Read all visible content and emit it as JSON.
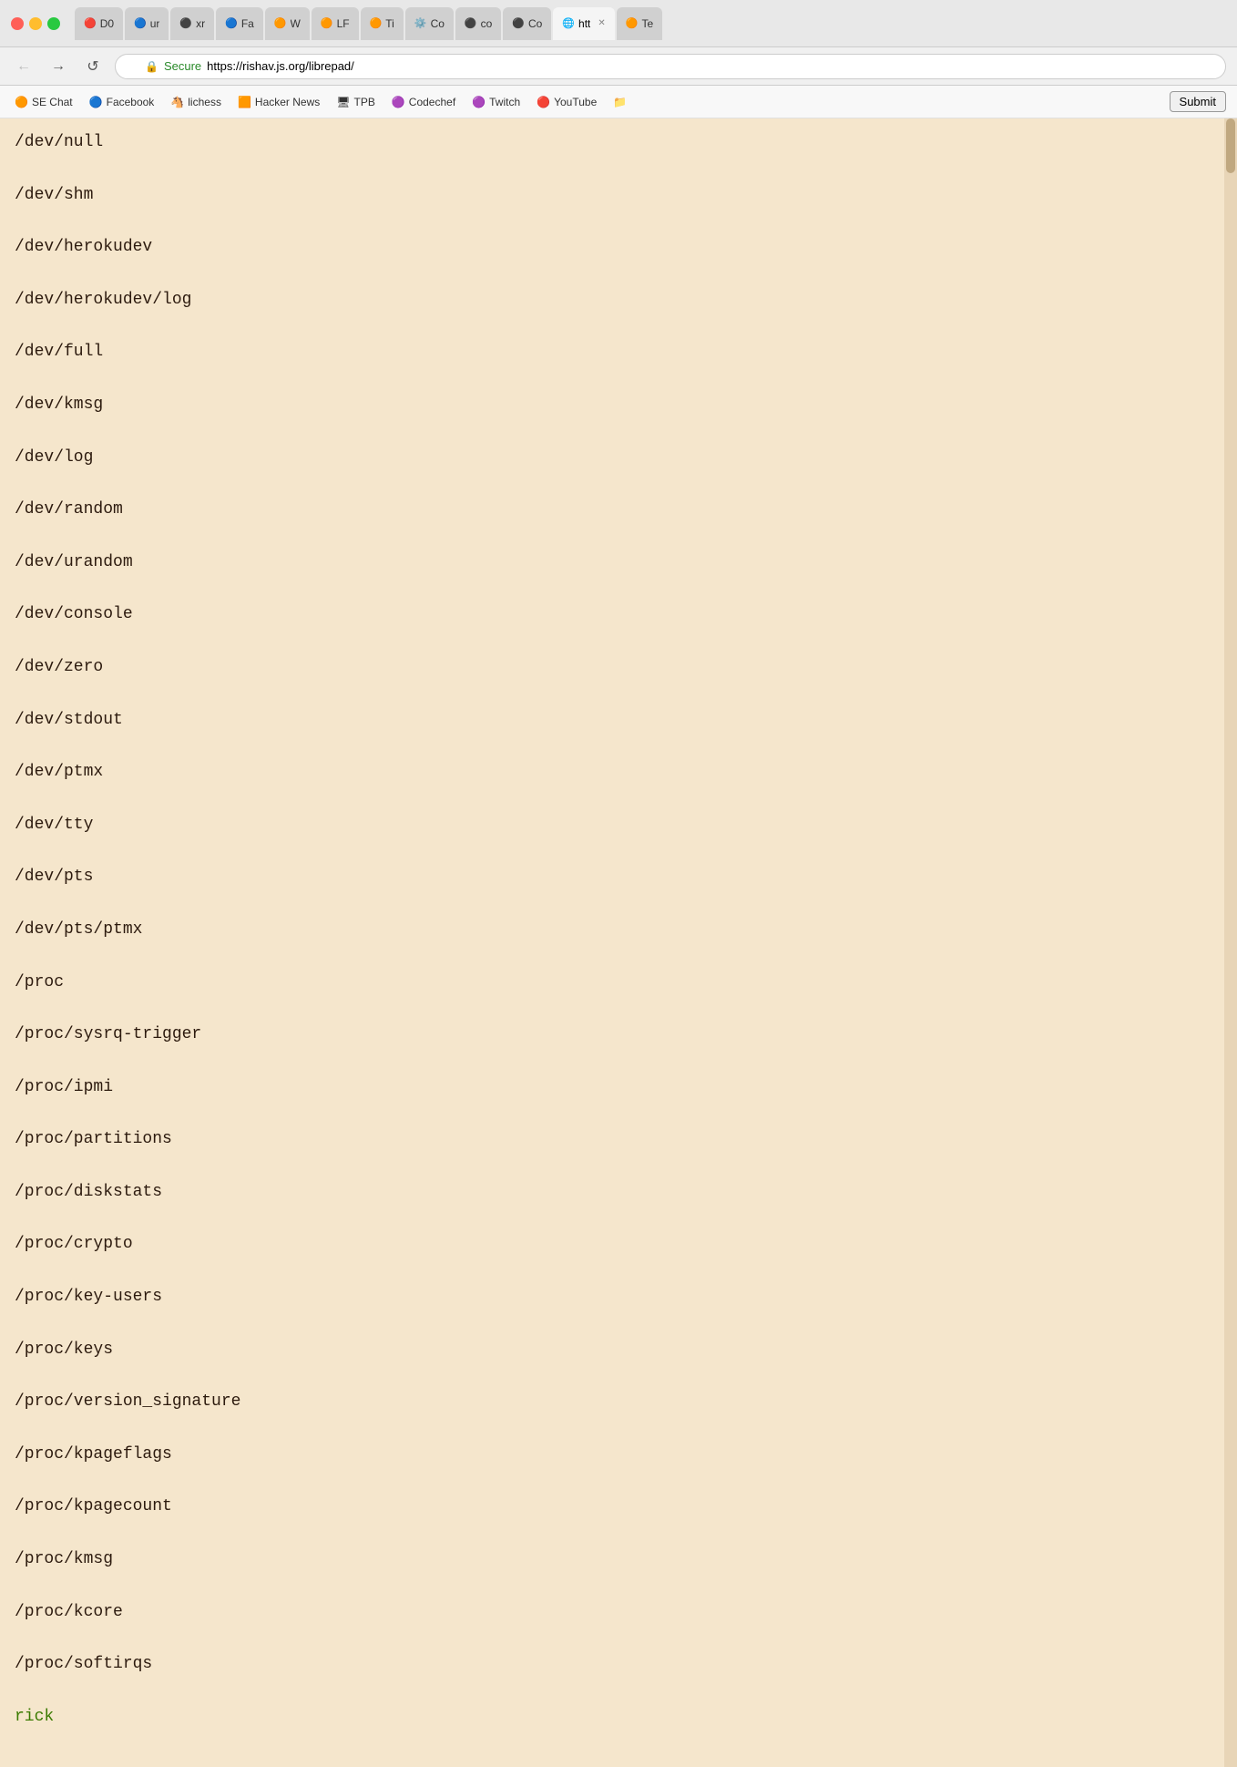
{
  "titlebar": {
    "tabs": [
      {
        "id": "tab-dc",
        "favicon": "🔴",
        "label": "D0",
        "active": false
      },
      {
        "id": "tab-g",
        "favicon": "🔵",
        "label": "ur",
        "active": false
      },
      {
        "id": "tab-gh1",
        "favicon": "⚫",
        "label": "xr",
        "active": false
      },
      {
        "id": "tab-fb",
        "favicon": "🔵",
        "label": "Fa",
        "active": false
      },
      {
        "id": "tab-rw",
        "favicon": "🟠",
        "label": "W",
        "active": false
      },
      {
        "id": "tab-rl",
        "favicon": "🟠",
        "label": "LF",
        "active": false
      },
      {
        "id": "tab-rt",
        "favicon": "🟠",
        "label": "Ti",
        "active": false
      },
      {
        "id": "tab-co",
        "favicon": "⚙️",
        "label": "Co",
        "active": false
      },
      {
        "id": "tab-gh2",
        "favicon": "⚫",
        "label": "co",
        "active": false
      },
      {
        "id": "tab-gh3",
        "favicon": "⚫",
        "label": "Co",
        "active": false
      },
      {
        "id": "tab-http",
        "favicon": "🌐",
        "label": "htt",
        "active": true,
        "closeable": true
      },
      {
        "id": "tab-te",
        "favicon": "🟠",
        "label": "Te",
        "active": false
      }
    ]
  },
  "addressbar": {
    "back_label": "←",
    "forward_label": "→",
    "reload_label": "↺",
    "secure_label": "Secure",
    "url": "https://rishav.js.org/librepad/"
  },
  "bookmarks": [
    {
      "id": "bm-sechat",
      "icon": "🟠",
      "label": "SE Chat"
    },
    {
      "id": "bm-facebook",
      "icon": "🔵",
      "label": "Facebook"
    },
    {
      "id": "bm-lichess",
      "icon": "🐴",
      "label": "lichess"
    },
    {
      "id": "bm-hackernews",
      "icon": "🟧",
      "label": "Hacker News"
    },
    {
      "id": "bm-tpb",
      "icon": "🖥",
      "label": "TPB"
    },
    {
      "id": "bm-codechef",
      "icon": "🟣",
      "label": "Codechef"
    },
    {
      "id": "bm-twitch",
      "icon": "🟣",
      "label": "Twitch"
    },
    {
      "id": "bm-youtube",
      "icon": "🔴",
      "label": "YouTube"
    },
    {
      "id": "bm-folder",
      "icon": "📁",
      "label": ""
    }
  ],
  "submit_label": "Submit",
  "content": {
    "lines": [
      {
        "text": "/dev/null",
        "class": ""
      },
      {
        "text": "/dev/shm",
        "class": ""
      },
      {
        "text": "/dev/herokudev",
        "class": ""
      },
      {
        "text": "/dev/herokudev/log",
        "class": ""
      },
      {
        "text": "/dev/full",
        "class": ""
      },
      {
        "text": "/dev/kmsg",
        "class": ""
      },
      {
        "text": "/dev/log",
        "class": ""
      },
      {
        "text": "/dev/random",
        "class": ""
      },
      {
        "text": "/dev/urandom",
        "class": ""
      },
      {
        "text": "/dev/console",
        "class": ""
      },
      {
        "text": "/dev/zero",
        "class": ""
      },
      {
        "text": "/dev/stdout",
        "class": ""
      },
      {
        "text": "/dev/ptmx",
        "class": ""
      },
      {
        "text": "/dev/tty",
        "class": ""
      },
      {
        "text": "/dev/pts",
        "class": ""
      },
      {
        "text": "/dev/pts/ptmx",
        "class": ""
      },
      {
        "text": "/proc",
        "class": ""
      },
      {
        "text": "/proc/sysrq-trigger",
        "class": ""
      },
      {
        "text": "/proc/ipmi",
        "class": ""
      },
      {
        "text": "/proc/partitions",
        "class": ""
      },
      {
        "text": "/proc/diskstats",
        "class": ""
      },
      {
        "text": "/proc/crypto",
        "class": ""
      },
      {
        "text": "/proc/key-users",
        "class": ""
      },
      {
        "text": "/proc/keys",
        "class": ""
      },
      {
        "text": "/proc/version_signature",
        "class": ""
      },
      {
        "text": "/proc/kpageflags",
        "class": ""
      },
      {
        "text": "/proc/kpagecount",
        "class": ""
      },
      {
        "text": "/proc/kmsg",
        "class": ""
      },
      {
        "text": "/proc/kcore",
        "class": ""
      },
      {
        "text": "/proc/softirqs",
        "class": ""
      },
      {
        "text": "rick",
        "class": "green"
      }
    ]
  }
}
